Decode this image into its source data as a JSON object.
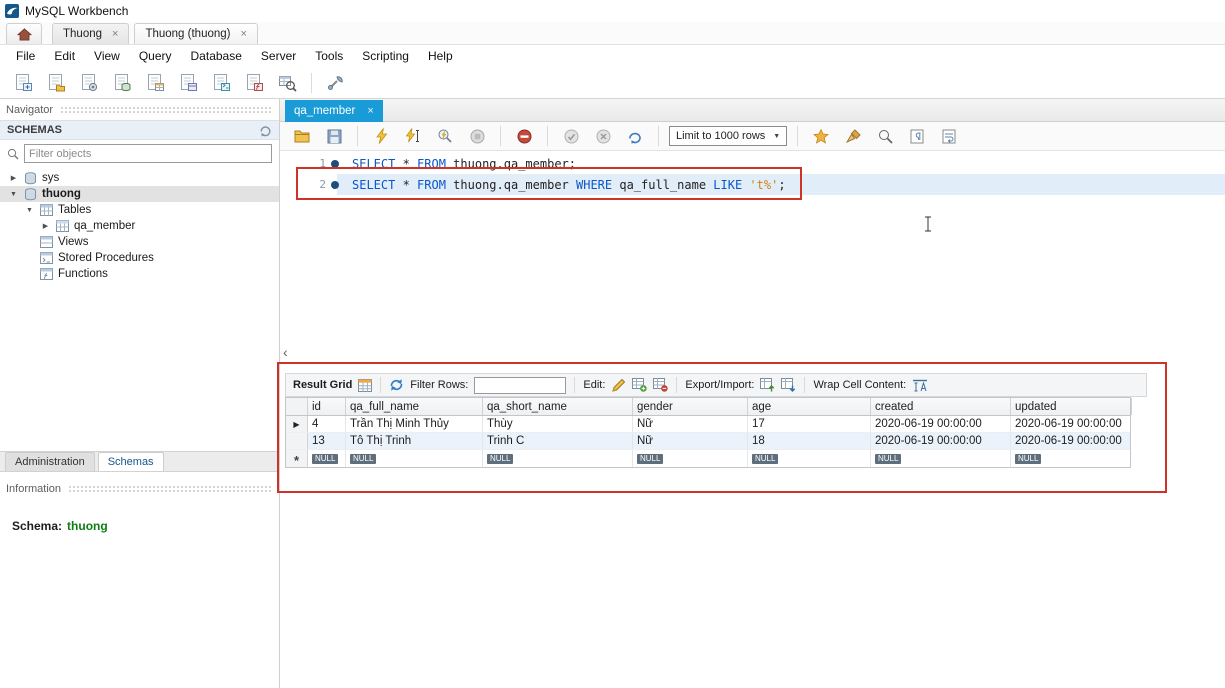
{
  "window": {
    "title": "MySQL Workbench"
  },
  "glyphs": {
    "close": "×",
    "collapsed": "▶",
    "expanded": "▼",
    "row_pointer": "▶",
    "new_row": "*",
    "dropdown_arrow": "▼",
    "panel_collapse": "‹"
  },
  "doc_tabs": {
    "tab1": "Thuong",
    "tab2": "Thuong (thuong)"
  },
  "menu": {
    "file": "File",
    "edit": "Edit",
    "view": "View",
    "query": "Query",
    "database": "Database",
    "server": "Server",
    "tools": "Tools",
    "scripting": "Scripting",
    "help": "Help"
  },
  "navigator": {
    "title": "Navigator",
    "schemas_header": "SCHEMAS",
    "filter_placeholder": "Filter objects",
    "tree": {
      "sys": "sys",
      "thuong": "thuong",
      "tables": "Tables",
      "qa_member": "qa_member",
      "views": "Views",
      "stored_procedures": "Stored Procedures",
      "functions": "Functions"
    },
    "bottom_tabs": {
      "administration": "Administration",
      "schemas": "Schemas"
    },
    "information_header": "Information",
    "schema_info": {
      "label": "Schema:",
      "value": "thuong"
    }
  },
  "editor": {
    "tab_label": "qa_member",
    "limit_dropdown": "Limit to 1000 rows",
    "line1": {
      "num": "1",
      "k1": "SELECT",
      "t1": " * ",
      "k2": "FROM",
      "t2": " thuong.qa_member;"
    },
    "line2": {
      "num": "2",
      "k1": "SELECT",
      "t1": " * ",
      "k2": "FROM",
      "t2": " thuong.qa_member ",
      "k3": "WHERE",
      "t3": " qa_full_name ",
      "k4": "LIKE",
      "s1": " 't%'",
      "t4": ";"
    }
  },
  "result": {
    "toolbar": {
      "title": "Result Grid",
      "filter_label": "Filter Rows:",
      "filter_value": "",
      "edit_label": "Edit:",
      "export_label": "Export/Import:",
      "wrap_label": "Wrap Cell Content:"
    },
    "columns": {
      "id": "id",
      "full_name": "qa_full_name",
      "short_name": "qa_short_name",
      "gender": "gender",
      "age": "age",
      "created": "created",
      "updated": "updated"
    },
    "rows": [
      {
        "id": "4",
        "full_name": "Trần Thị Minh Thủy",
        "short_name": "Thùy",
        "gender": "Nữ",
        "age": "17",
        "created": "2020-06-19 00:00:00",
        "updated": "2020-06-19 00:00:00"
      },
      {
        "id": "13",
        "full_name": "Tô Thị Trinh",
        "short_name": "Trinh C",
        "gender": "Nữ",
        "age": "18",
        "created": "2020-06-19 00:00:00",
        "updated": "2020-06-19 00:00:00"
      }
    ],
    "null_text": "NULL"
  }
}
